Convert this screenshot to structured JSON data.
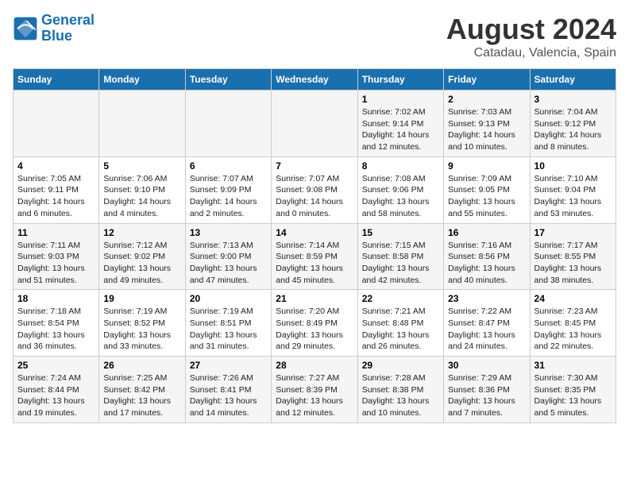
{
  "logo": {
    "line1": "General",
    "line2": "Blue"
  },
  "title": "August 2024",
  "subtitle": "Catadau, Valencia, Spain",
  "days_of_week": [
    "Sunday",
    "Monday",
    "Tuesday",
    "Wednesday",
    "Thursday",
    "Friday",
    "Saturday"
  ],
  "weeks": [
    [
      {
        "day": "",
        "info": ""
      },
      {
        "day": "",
        "info": ""
      },
      {
        "day": "",
        "info": ""
      },
      {
        "day": "",
        "info": ""
      },
      {
        "day": "1",
        "info": "Sunrise: 7:02 AM\nSunset: 9:14 PM\nDaylight: 14 hours and 12 minutes."
      },
      {
        "day": "2",
        "info": "Sunrise: 7:03 AM\nSunset: 9:13 PM\nDaylight: 14 hours and 10 minutes."
      },
      {
        "day": "3",
        "info": "Sunrise: 7:04 AM\nSunset: 9:12 PM\nDaylight: 14 hours and 8 minutes."
      }
    ],
    [
      {
        "day": "4",
        "info": "Sunrise: 7:05 AM\nSunset: 9:11 PM\nDaylight: 14 hours and 6 minutes."
      },
      {
        "day": "5",
        "info": "Sunrise: 7:06 AM\nSunset: 9:10 PM\nDaylight: 14 hours and 4 minutes."
      },
      {
        "day": "6",
        "info": "Sunrise: 7:07 AM\nSunset: 9:09 PM\nDaylight: 14 hours and 2 minutes."
      },
      {
        "day": "7",
        "info": "Sunrise: 7:07 AM\nSunset: 9:08 PM\nDaylight: 14 hours and 0 minutes."
      },
      {
        "day": "8",
        "info": "Sunrise: 7:08 AM\nSunset: 9:06 PM\nDaylight: 13 hours and 58 minutes."
      },
      {
        "day": "9",
        "info": "Sunrise: 7:09 AM\nSunset: 9:05 PM\nDaylight: 13 hours and 55 minutes."
      },
      {
        "day": "10",
        "info": "Sunrise: 7:10 AM\nSunset: 9:04 PM\nDaylight: 13 hours and 53 minutes."
      }
    ],
    [
      {
        "day": "11",
        "info": "Sunrise: 7:11 AM\nSunset: 9:03 PM\nDaylight: 13 hours and 51 minutes."
      },
      {
        "day": "12",
        "info": "Sunrise: 7:12 AM\nSunset: 9:02 PM\nDaylight: 13 hours and 49 minutes."
      },
      {
        "day": "13",
        "info": "Sunrise: 7:13 AM\nSunset: 9:00 PM\nDaylight: 13 hours and 47 minutes."
      },
      {
        "day": "14",
        "info": "Sunrise: 7:14 AM\nSunset: 8:59 PM\nDaylight: 13 hours and 45 minutes."
      },
      {
        "day": "15",
        "info": "Sunrise: 7:15 AM\nSunset: 8:58 PM\nDaylight: 13 hours and 42 minutes."
      },
      {
        "day": "16",
        "info": "Sunrise: 7:16 AM\nSunset: 8:56 PM\nDaylight: 13 hours and 40 minutes."
      },
      {
        "day": "17",
        "info": "Sunrise: 7:17 AM\nSunset: 8:55 PM\nDaylight: 13 hours and 38 minutes."
      }
    ],
    [
      {
        "day": "18",
        "info": "Sunrise: 7:18 AM\nSunset: 8:54 PM\nDaylight: 13 hours and 36 minutes."
      },
      {
        "day": "19",
        "info": "Sunrise: 7:19 AM\nSunset: 8:52 PM\nDaylight: 13 hours and 33 minutes."
      },
      {
        "day": "20",
        "info": "Sunrise: 7:19 AM\nSunset: 8:51 PM\nDaylight: 13 hours and 31 minutes."
      },
      {
        "day": "21",
        "info": "Sunrise: 7:20 AM\nSunset: 8:49 PM\nDaylight: 13 hours and 29 minutes."
      },
      {
        "day": "22",
        "info": "Sunrise: 7:21 AM\nSunset: 8:48 PM\nDaylight: 13 hours and 26 minutes."
      },
      {
        "day": "23",
        "info": "Sunrise: 7:22 AM\nSunset: 8:47 PM\nDaylight: 13 hours and 24 minutes."
      },
      {
        "day": "24",
        "info": "Sunrise: 7:23 AM\nSunset: 8:45 PM\nDaylight: 13 hours and 22 minutes."
      }
    ],
    [
      {
        "day": "25",
        "info": "Sunrise: 7:24 AM\nSunset: 8:44 PM\nDaylight: 13 hours and 19 minutes."
      },
      {
        "day": "26",
        "info": "Sunrise: 7:25 AM\nSunset: 8:42 PM\nDaylight: 13 hours and 17 minutes."
      },
      {
        "day": "27",
        "info": "Sunrise: 7:26 AM\nSunset: 8:41 PM\nDaylight: 13 hours and 14 minutes."
      },
      {
        "day": "28",
        "info": "Sunrise: 7:27 AM\nSunset: 8:39 PM\nDaylight: 13 hours and 12 minutes."
      },
      {
        "day": "29",
        "info": "Sunrise: 7:28 AM\nSunset: 8:38 PM\nDaylight: 13 hours and 10 minutes."
      },
      {
        "day": "30",
        "info": "Sunrise: 7:29 AM\nSunset: 8:36 PM\nDaylight: 13 hours and 7 minutes."
      },
      {
        "day": "31",
        "info": "Sunrise: 7:30 AM\nSunset: 8:35 PM\nDaylight: 13 hours and 5 minutes."
      }
    ]
  ]
}
